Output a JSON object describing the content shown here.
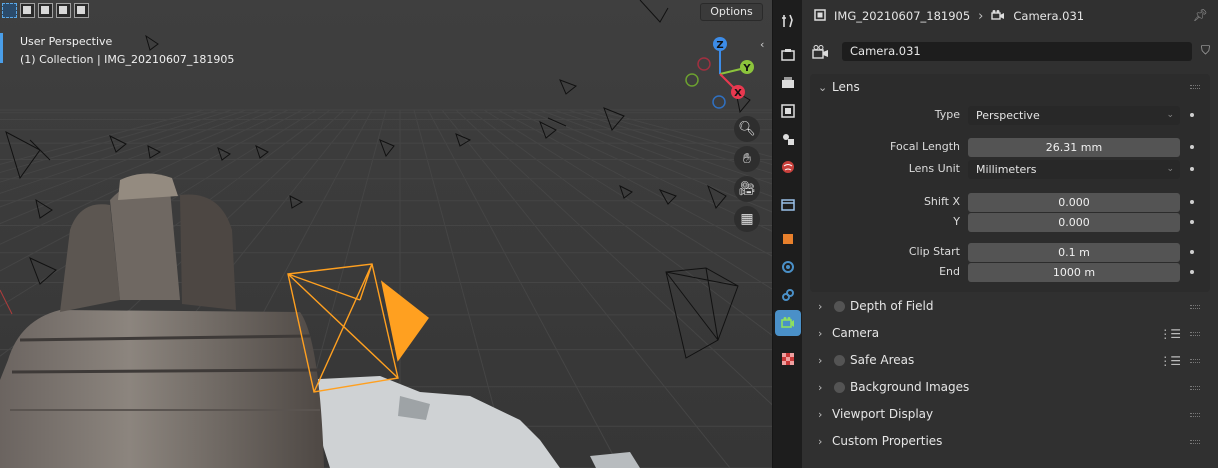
{
  "viewport": {
    "options_label": "Options",
    "view_name": "User Perspective",
    "collection_info": "(1) Collection | IMG_20210607_181905",
    "gizmo": {
      "z": "Z",
      "y": "Y",
      "x": "X"
    }
  },
  "properties": {
    "breadcrumb": {
      "object": "IMG_20210607_181905",
      "data": "Camera.031"
    },
    "datablock_name": "Camera.031",
    "lens": {
      "header": "Lens",
      "type_label": "Type",
      "type_value": "Perspective",
      "focal_label": "Focal Length",
      "focal_value": "26.31 mm",
      "unit_label": "Lens Unit",
      "unit_value": "Millimeters",
      "shiftx_label": "Shift X",
      "shiftx_value": "0.000",
      "shifty_label": "Y",
      "shifty_value": "0.000",
      "clipstart_label": "Clip Start",
      "clipstart_value": "0.1 m",
      "clipend_label": "End",
      "clipend_value": "1000 m"
    },
    "sections": {
      "dof": "Depth of Field",
      "camera": "Camera",
      "safe_areas": "Safe Areas",
      "background_images": "Background Images",
      "viewport_display": "Viewport Display",
      "custom_properties": "Custom Properties"
    }
  },
  "colors": {
    "accent_blue": "#4a90c8",
    "camera_orange": "#ffa020",
    "axis_x": "#e8384f",
    "axis_y": "#8cc43c",
    "axis_z": "#3c8ce8"
  }
}
